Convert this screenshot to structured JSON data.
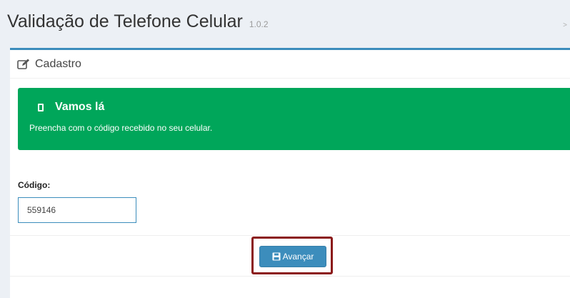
{
  "header": {
    "title": "Validação de Telefone Celular",
    "version": "1.0.2",
    "breadcrumb_arrow": ">"
  },
  "box": {
    "title": "Cadastro",
    "title_icon": "edit-icon"
  },
  "callout": {
    "icon": "mobile-phone-icon",
    "title": "Vamos lá",
    "text": "Preencha com o código recebido no seu celular.",
    "color": "#00a65a"
  },
  "form": {
    "code_label": "Código:",
    "code_value": "559146"
  },
  "footer": {
    "submit_label": "Avançar",
    "submit_icon": "save-icon"
  },
  "colors": {
    "primary": "#3c8dbc",
    "success": "#00a65a",
    "highlight": "#8b1a1a",
    "background": "#ecf0f5"
  }
}
